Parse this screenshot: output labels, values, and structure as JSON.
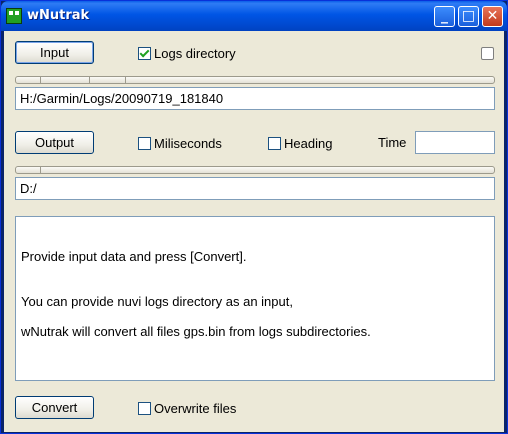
{
  "window": {
    "title": "wNutrak"
  },
  "input": {
    "button_label": "Input",
    "logs_directory_label": "Logs directory",
    "logs_directory_checked": true,
    "path_value": "H:/Garmin/Logs/20090719_181840"
  },
  "output": {
    "button_label": "Output",
    "miliseconds_label": "Miliseconds",
    "heading_label": "Heading",
    "time_label": "Time",
    "time_value": "",
    "path_value": "D:/"
  },
  "info": {
    "line1": "Provide input data and press [Convert].",
    "line2": "You can provide nuvi logs directory as an input,",
    "line3": "wNutrak will convert all files gps.bin from logs subdirectories."
  },
  "footer": {
    "convert_label": "Convert",
    "overwrite_label": "Overwrite files"
  }
}
